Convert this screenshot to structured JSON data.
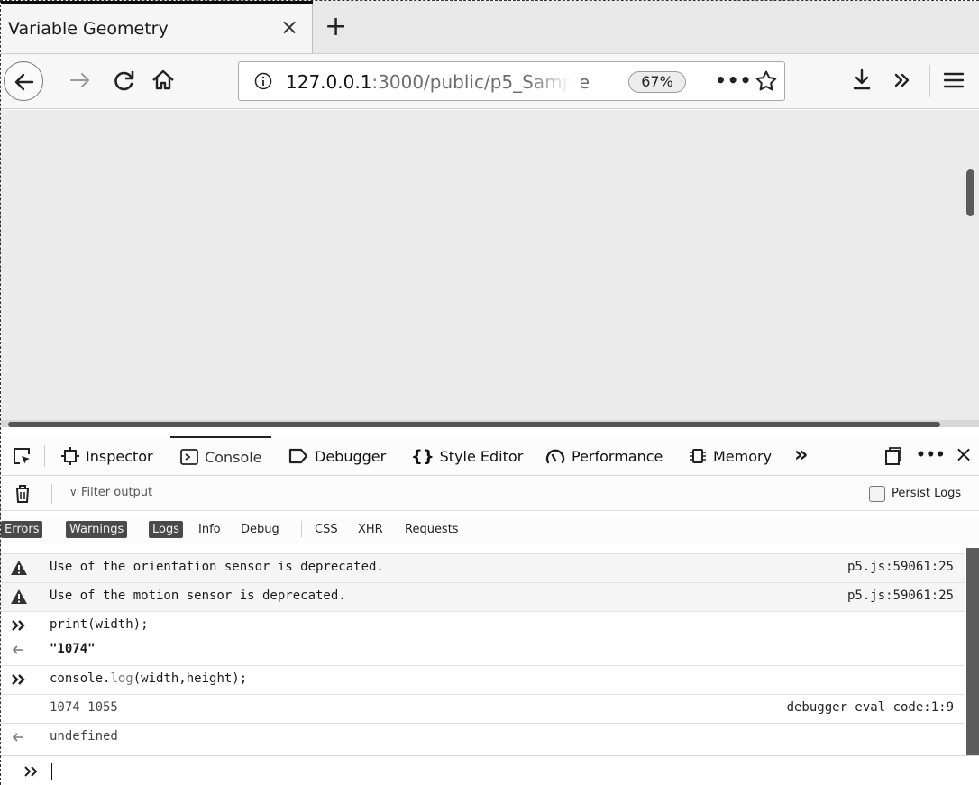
{
  "browser": {
    "tab_title": "Variable Geometry",
    "tab_close": "×",
    "new_tab": "+",
    "url_host": "127.0.0.1",
    "url_rest": ":3000/public/p5_Sample",
    "zoom": "67%",
    "url_more": "•••"
  },
  "devtools": {
    "tabs": {
      "inspector": "Inspector",
      "console": "Console",
      "debugger": "Debugger",
      "style_editor": "Style Editor",
      "performance": "Performance",
      "memory": "Memory"
    },
    "more_tabs": "»",
    "menu": "•••",
    "close": "×",
    "active_tab": "Console"
  },
  "filter": {
    "placeholder": "Filter output",
    "persist_logs": "Persist Logs"
  },
  "categories": {
    "errors": "Errors",
    "warnings": "Warnings",
    "logs": "Logs",
    "info": "Info",
    "debug": "Debug",
    "css": "CSS",
    "xhr": "XHR",
    "requests": "Requests"
  },
  "console": {
    "warn1": {
      "message": "Use of the orientation sensor is deprecated.",
      "location": "p5.js:59061:25"
    },
    "warn2": {
      "message": "Use of the motion sensor is deprecated.",
      "location": "p5.js:59061:25"
    },
    "input1": "print(width);",
    "result1": "\"1074\"",
    "input2_obj": "console.",
    "input2_fn": "log",
    "input2_args": "(width,height);",
    "log_output": "1074 1055",
    "log_location": "debugger eval code:1:9",
    "result2": "undefined"
  },
  "colors": {
    "active_category_bg": "#4a4a4a",
    "content_bg": "#ebebeb",
    "warning_row_bg": "#f5f5f5"
  }
}
